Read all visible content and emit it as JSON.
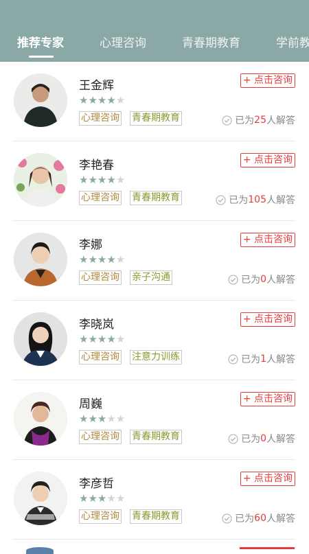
{
  "tabs": [
    {
      "label": "推荐专家"
    },
    {
      "label": "心理咨询"
    },
    {
      "label": "青春期教育"
    },
    {
      "label": "学前教"
    }
  ],
  "common": {
    "consult_label": "+ 点击咨询",
    "answered_prefix": "已为",
    "answered_suffix": "人解答",
    "star_char": "★"
  },
  "experts": [
    {
      "name": "王金辉",
      "stars": 4,
      "tags": [
        "心理咨询",
        "青春期教育"
      ],
      "answered": "25"
    },
    {
      "name": "李艳春",
      "stars": 4,
      "tags": [
        "心理咨询",
        "青春期教育"
      ],
      "answered": "105"
    },
    {
      "name": "李娜",
      "stars": 4,
      "tags": [
        "心理咨询",
        "亲子沟通"
      ],
      "answered": "0"
    },
    {
      "name": "李晓岚",
      "stars": 4,
      "tags": [
        "心理咨询",
        "注意力训练"
      ],
      "answered": "1"
    },
    {
      "name": "周巍",
      "stars": 3,
      "tags": [
        "心理咨询",
        "青春期教育"
      ],
      "answered": "0"
    },
    {
      "name": "李彦哲",
      "stars": 3,
      "tags": [
        "心理咨询",
        "青春期教育"
      ],
      "answered": "60"
    }
  ],
  "colors": {
    "header": "#8aa9a6",
    "accent_red": "#e53b3b",
    "star_on": "#8aa9a6",
    "star_off": "#d4d4d4"
  }
}
